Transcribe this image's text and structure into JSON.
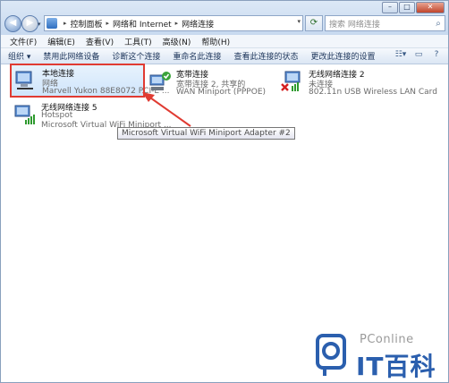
{
  "address": {
    "segments": [
      "控制面板",
      "网络和 Internet",
      "网络连接"
    ],
    "arrow": "▸"
  },
  "search": {
    "placeholder": "搜索 网络连接"
  },
  "menu": [
    "文件(F)",
    "编辑(E)",
    "查看(V)",
    "工具(T)",
    "高级(N)",
    "帮助(H)"
  ],
  "commands": [
    "组织 ▾",
    "禁用此网络设备",
    "诊断这个连接",
    "重命名此连接",
    "查看此连接的状态",
    "更改此连接的设置"
  ],
  "connections": [
    {
      "name": "本地连接",
      "status": "网络",
      "device": "Marvell Yukon 88E8072 PCI-E ...",
      "kind": "wired",
      "selected": true
    },
    {
      "name": "宽带连接",
      "status": "宽带连接 2, 共享的",
      "device": "WAN Miniport (PPPOE)",
      "kind": "broadband",
      "selected": false
    },
    {
      "name": "无线网络连接 2",
      "status": "未连接",
      "device": "802.11n USB Wireless LAN Card",
      "kind": "wireless-off",
      "selected": false
    },
    {
      "name": "无线网络连接 5",
      "status": "Hotspot",
      "device": "Microsoft Virtual WiFi Miniport ...",
      "kind": "wireless",
      "selected": false
    }
  ],
  "tooltip": "Microsoft Virtual WiFi Miniport Adapter #2",
  "watermark": {
    "brand": "PConline",
    "name": "IT百科"
  },
  "colors": {
    "annotation_red": "#e03b32",
    "selection_blue": "#cfe5fb",
    "watermark_blue": "#2b5fae"
  }
}
